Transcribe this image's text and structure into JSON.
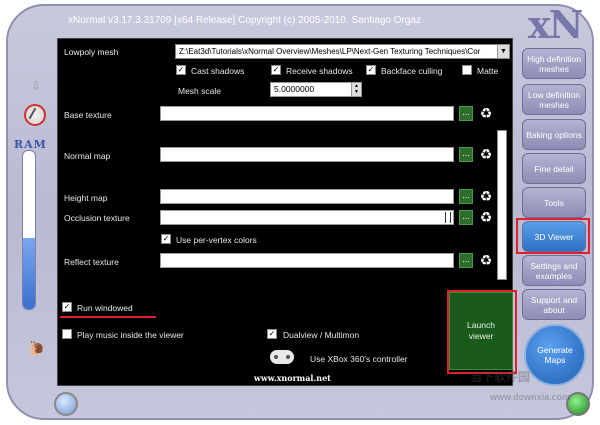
{
  "window": {
    "title": "xNormal v3.17.3.31709 [x64 Release] Copyright (c) 2005-2010. Santiago Orgaz",
    "logo": "xN"
  },
  "mesh": {
    "lowpoly_label": "Lowpoly mesh",
    "lowpoly_path": "Z:\\Eat3d\\Tutorials\\xNormal Overview\\Meshes\\LP\\Next-Gen Texturing Techniques\\Cor",
    "cast_shadows_label": "Cast shadows",
    "receive_shadows_label": "Receive shadows",
    "backface_culling_label": "Backface culling",
    "matte_label": "Matte",
    "mesh_scale_label": "Mesh scale",
    "mesh_scale_value": "5.0000000"
  },
  "textures": {
    "base_label": "Base texture",
    "normal_label": "Normal map",
    "height_label": "Height map",
    "occlusion_label": "Occlusion texture",
    "per_vertex_label": "Use per-vertex colors",
    "reflect_label": "Reflect texture",
    "browse_label": "...",
    "recycle_glyph": "♻"
  },
  "options": {
    "run_windowed_label": "Run windowed",
    "play_music_label": "Play music inside the viewer",
    "dualview_label": "Dualview / Multimon",
    "xbox_label": "Use XBox 360's controller",
    "check_glyph": "✓"
  },
  "sidebar": {
    "items": [
      {
        "label": "High definition meshes"
      },
      {
        "label": "Low definition meshes"
      },
      {
        "label": "Baking options"
      },
      {
        "label": "Fine detail"
      },
      {
        "label": "Tools"
      },
      {
        "label": "3D Viewer"
      },
      {
        "label": "Settings and examples"
      },
      {
        "label": "Support and about"
      }
    ],
    "generate_label": "Generate Maps"
  },
  "launch_label": "Launch viewer",
  "ram_label": "RAM",
  "ram_usage_fraction": 0.45,
  "website": "www.xnormal.net",
  "watermark": {
    "brand": "当下软件园",
    "url": "www.downxia.com"
  },
  "colors": {
    "accent_red": "#e0202a",
    "launch_green": "#1a5a1a",
    "active_blue": "#2d6fc7"
  }
}
